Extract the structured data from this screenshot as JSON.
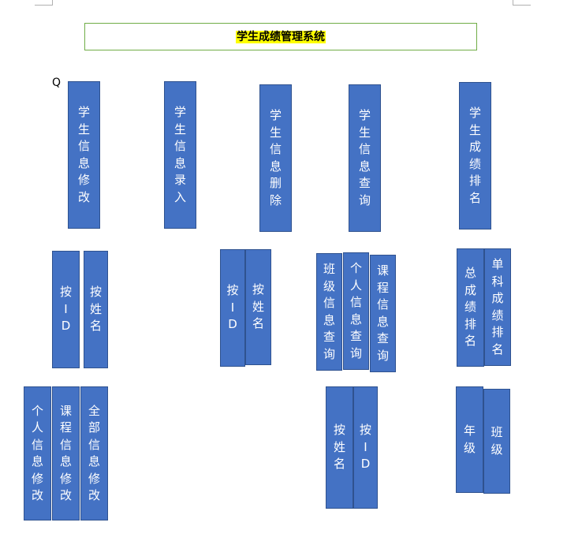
{
  "title": "学生成绩管理系统",
  "cursor_glyph": "Q",
  "colors": {
    "box_fill": "#4472c4",
    "box_border": "#2f528f",
    "title_highlight": "#ffff00",
    "title_border": "#70ad47"
  },
  "level1": [
    {
      "label": "学生信息修改"
    },
    {
      "label": "学生信息录入"
    },
    {
      "label": "学生信息删除"
    },
    {
      "label": "学生信息查询"
    },
    {
      "label": "学生成绩排名"
    }
  ],
  "level2": {
    "modify": [
      {
        "label": "按ID"
      },
      {
        "label": "按姓名"
      }
    ],
    "delete": [
      {
        "label": "按ID"
      },
      {
        "label": "按姓名"
      }
    ],
    "query": [
      {
        "label": "班级信息查询"
      },
      {
        "label": "个人信息查询"
      },
      {
        "label": "课程信息查询"
      }
    ],
    "ranking": [
      {
        "label": "总成绩排名"
      },
      {
        "label": "单科成绩排名"
      }
    ]
  },
  "level3": {
    "modify": [
      {
        "label": "个人信息修改"
      },
      {
        "label": "课程信息修改"
      },
      {
        "label": "全部信息修改"
      }
    ],
    "query": [
      {
        "label": "按姓名"
      },
      {
        "label": "按ID"
      }
    ],
    "ranking": [
      {
        "label": "年级"
      },
      {
        "label": "班级"
      }
    ]
  }
}
